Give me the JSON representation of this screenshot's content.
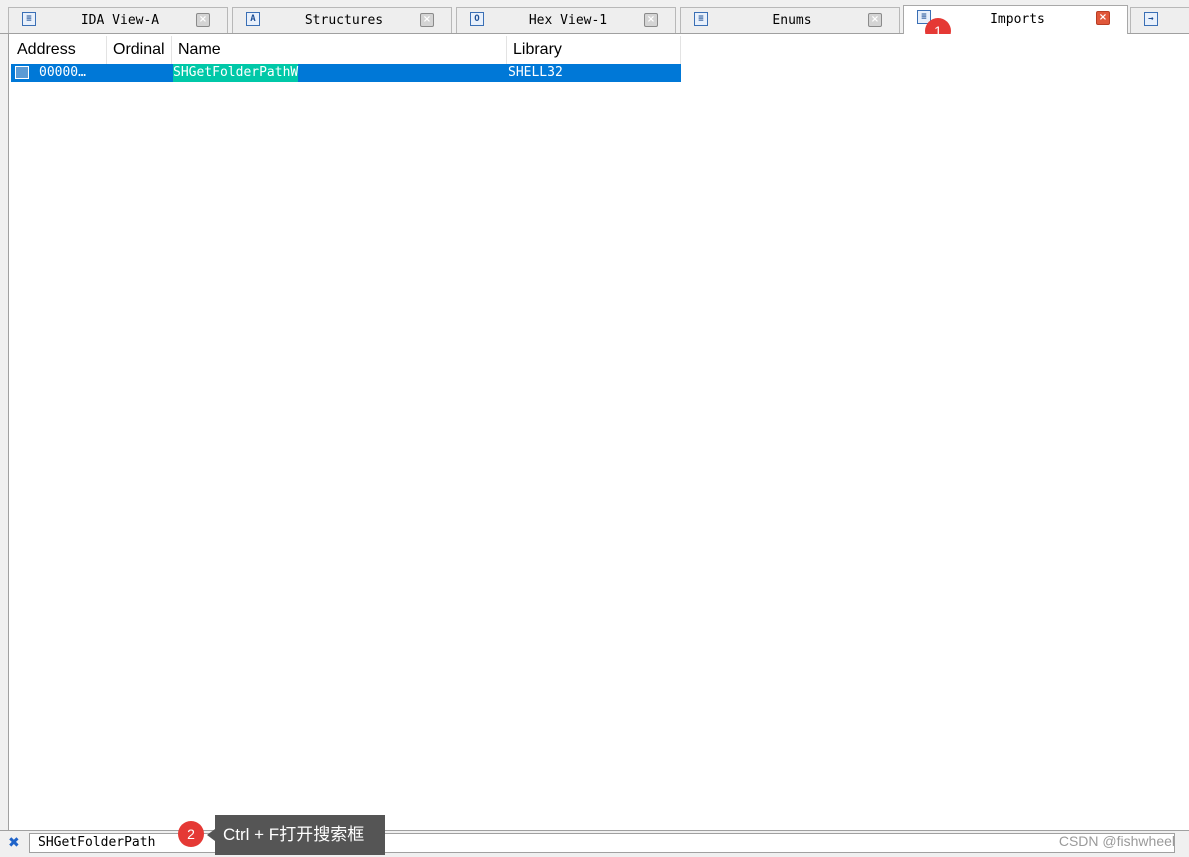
{
  "tabs": [
    {
      "label": "IDA View-A",
      "icon": "ida-view-icon",
      "glyph": "≡",
      "active": false
    },
    {
      "label": "Structures",
      "icon": "structures-icon",
      "glyph": "A",
      "active": false
    },
    {
      "label": "Hex View-1",
      "icon": "hex-view-icon",
      "glyph": "O",
      "active": false
    },
    {
      "label": "Enums",
      "icon": "enums-icon",
      "glyph": "≡",
      "active": false
    },
    {
      "label": "Imports",
      "icon": "imports-icon",
      "glyph": "≡",
      "active": true
    },
    {
      "label": "",
      "icon": "exports-icon",
      "glyph": "→",
      "active": false
    }
  ],
  "table": {
    "columns": [
      "Address",
      "Ordinal",
      "Name",
      "Library"
    ],
    "rows": [
      {
        "address": "00000…",
        "ordinal": "",
        "name": "SHGetFolderPathW",
        "library": "SHELL32",
        "selected": true
      }
    ]
  },
  "search": {
    "value": "SHGetFolderPath"
  },
  "annotations": {
    "badge_1": "1",
    "badge_2": "2",
    "tooltip": "Ctrl + F打开搜索框"
  },
  "watermark": "CSDN @fishwheel",
  "colors": {
    "selection": "#0078d7",
    "highlight": "#00c8a8",
    "badge": "#e53935"
  }
}
